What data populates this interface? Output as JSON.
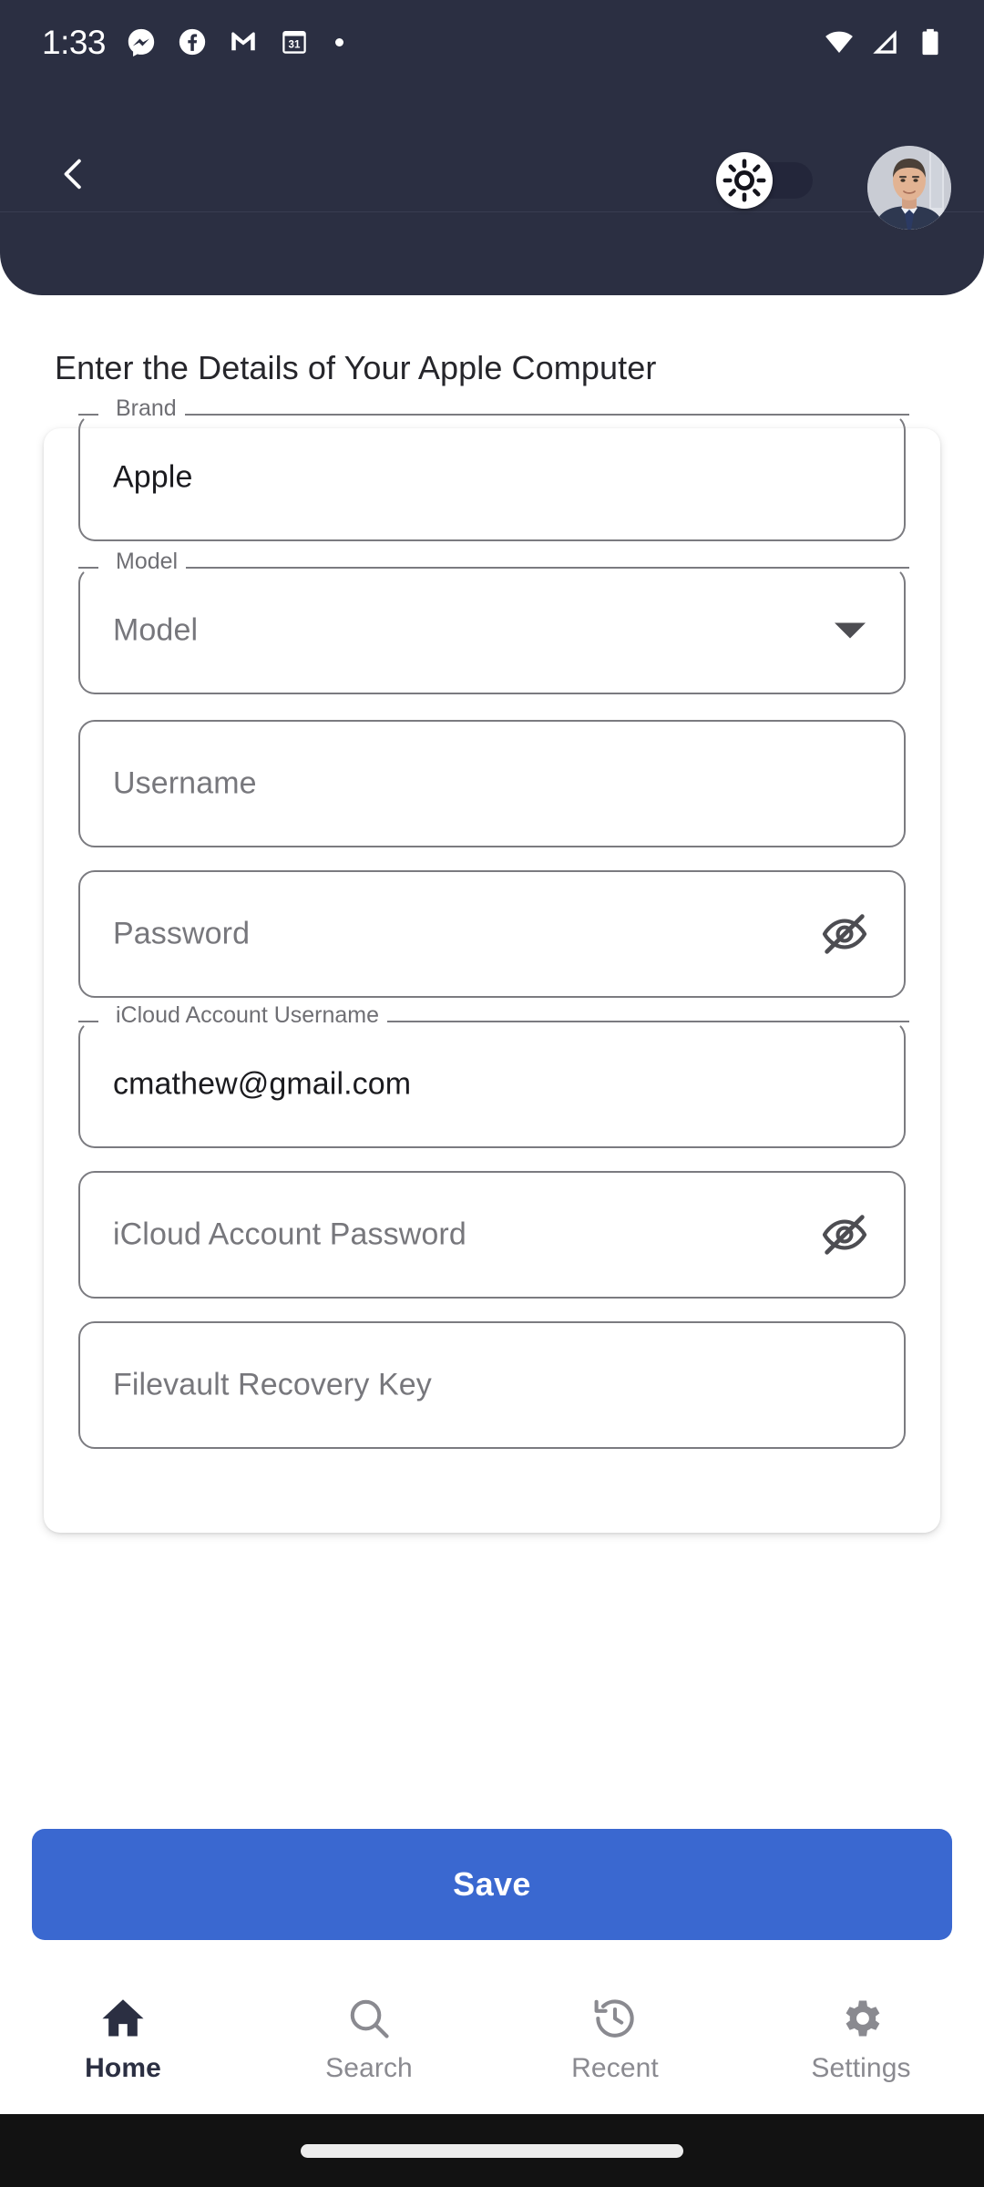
{
  "status_bar": {
    "time": "1:33",
    "left_icons": [
      "messenger-icon",
      "facebook-icon",
      "gmail-icon",
      "calendar-31-icon",
      "dot-indicator-icon"
    ],
    "calendar_day": "31",
    "right_icons": [
      "wifi-icon",
      "cellular-signal-icon",
      "battery-icon"
    ]
  },
  "app_bar": {
    "back_icon": "chevron-left-icon",
    "theme_toggle": {
      "icon": "brightness-sun-icon",
      "state": "off"
    },
    "avatar": {
      "icon": "user-avatar-photo",
      "alt": "profile photo"
    },
    "background_color": "#2b2f42"
  },
  "page": {
    "title": "Enter the Details of Your Apple Computer"
  },
  "form": {
    "fields": [
      {
        "name": "brand",
        "label": "Brand",
        "value": "Apple",
        "placeholder": "Brand",
        "type": "text",
        "filled": true,
        "trailing_icon": null
      },
      {
        "name": "model",
        "label": "Model",
        "value": "Model",
        "placeholder": "Model",
        "type": "dropdown",
        "filled": false,
        "trailing_icon": "chevron-down-icon"
      },
      {
        "name": "username",
        "label": "Username",
        "value": "",
        "placeholder": "Username",
        "type": "text",
        "filled": false,
        "trailing_icon": null
      },
      {
        "name": "password",
        "label": "Password",
        "value": "",
        "placeholder": "Password",
        "type": "password",
        "filled": false,
        "trailing_icon": "eye-off-icon"
      },
      {
        "name": "icloud-username",
        "label": "iCloud Account Username",
        "value": "cmathew@gmail.com",
        "placeholder": "iCloud Account Username",
        "type": "email",
        "filled": true,
        "trailing_icon": null
      },
      {
        "name": "icloud-password",
        "label": "iCloud Account Password",
        "value": "",
        "placeholder": "iCloud Account Password",
        "type": "password",
        "filled": false,
        "trailing_icon": "eye-off-icon"
      },
      {
        "name": "filevault-key",
        "label": "Filevault Recovery Key",
        "value": "",
        "placeholder": "Filevault Recovery Key",
        "type": "text",
        "filled": false,
        "trailing_icon": null
      }
    ]
  },
  "actions": {
    "save_label": "Save",
    "save_color": "#3a68d0"
  },
  "bottom_nav": {
    "items": [
      {
        "label": "Home",
        "icon": "home-icon",
        "active": true
      },
      {
        "label": "Search",
        "icon": "search-icon",
        "active": false
      },
      {
        "label": "Recent",
        "icon": "history-icon",
        "active": false
      },
      {
        "label": "Settings",
        "icon": "gear-icon",
        "active": false
      }
    ],
    "active_color": "#2b2f42",
    "inactive_color": "#8a8a90"
  }
}
